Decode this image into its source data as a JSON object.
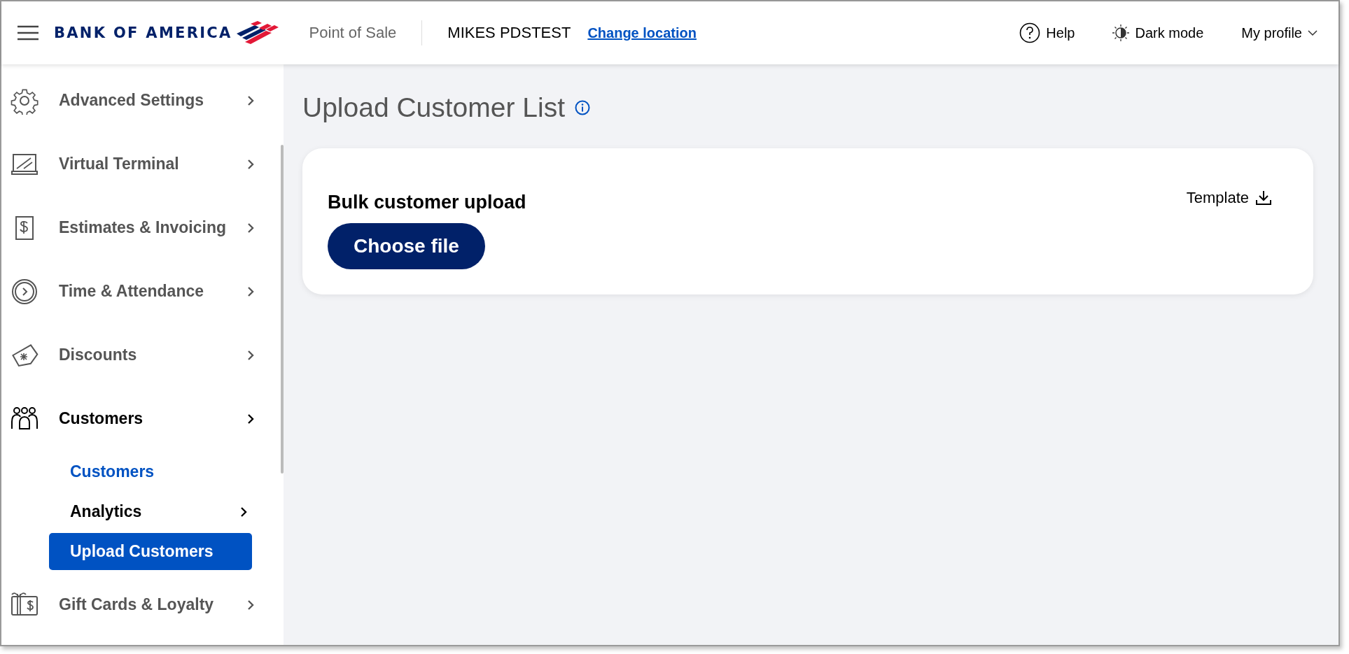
{
  "header": {
    "logo": "BANK OF AMERICA",
    "product": "Point of Sale",
    "location": "MIKES PDSTEST",
    "change_location": "Change location",
    "help": "Help",
    "dark_mode": "Dark mode",
    "profile": "My profile"
  },
  "sidebar": {
    "items": [
      {
        "label": "Advanced Settings",
        "expanded": false
      },
      {
        "label": "Virtual Terminal",
        "expanded": false
      },
      {
        "label": "Estimates & Invoicing",
        "expanded": false
      },
      {
        "label": "Time & Attendance",
        "expanded": false
      },
      {
        "label": "Discounts",
        "expanded": false
      },
      {
        "label": "Customers",
        "expanded": true,
        "children": [
          {
            "label": "Customers",
            "kind": "link",
            "selected": false
          },
          {
            "label": "Analytics",
            "kind": "submenu",
            "selected": false
          },
          {
            "label": "Upload Customers",
            "kind": "link",
            "selected": true
          }
        ]
      },
      {
        "label": "Gift Cards & Loyalty",
        "expanded": false
      }
    ]
  },
  "page": {
    "title": "Upload Customer List",
    "card": {
      "heading": "Bulk customer upload",
      "button": "Choose file",
      "template": "Template"
    }
  }
}
